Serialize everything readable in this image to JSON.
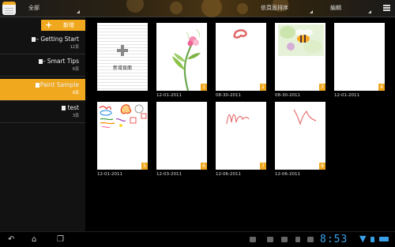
{
  "topbar": {
    "scope_label": "全部",
    "sort_label": "依頁面排序",
    "edit_label": "編輯"
  },
  "sidebar": {
    "add_label": "新增",
    "items": [
      {
        "name": "-- Getting Start",
        "count": "12頁",
        "active": false
      },
      {
        "name": "-- Smart Tips",
        "count": "6頁",
        "active": false
      },
      {
        "name": "Paint Sample",
        "count": "8頁",
        "active": true
      },
      {
        "name": "test",
        "count": "3頁",
        "active": false
      }
    ]
  },
  "grid": {
    "new_page_label": "新增頁面",
    "pages": [
      {
        "num": "1",
        "date": "12-01-2011",
        "thumb": "flower-drawing"
      },
      {
        "num": "2",
        "date": "08-30-2011",
        "thumb": "pink-scribble"
      },
      {
        "num": "3",
        "date": "08-30-2011",
        "thumb": "bee-painting"
      },
      {
        "num": "4",
        "date": "12-01-2011",
        "thumb": "blank"
      },
      {
        "num": "5",
        "date": "12-01-2011",
        "thumb": "colorful-doodles"
      },
      {
        "num": "6",
        "date": "12-03-2011",
        "thumb": "blank"
      },
      {
        "num": "7",
        "date": "12-06-2011",
        "thumb": "red-squiggle"
      },
      {
        "num": "8",
        "date": "12-06-2011",
        "thumb": "red-squiggle-2"
      }
    ]
  },
  "sysbar": {
    "clock": "8:53"
  },
  "colors": {
    "accent": "#f0a81f",
    "clock": "#3aa0e8"
  }
}
